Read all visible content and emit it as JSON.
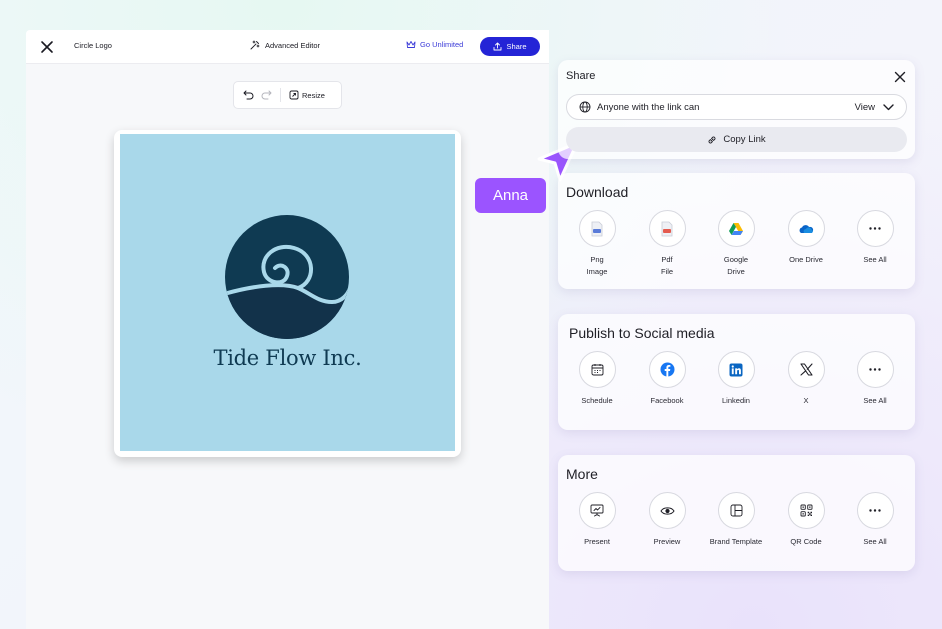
{
  "topbar": {
    "doc_title": "Circle Logo",
    "advanced_editor": "Advanced Editor",
    "go_unlimited": "Go Unlimited",
    "share": "Share"
  },
  "toolbar": {
    "resize": "Resize"
  },
  "canvas": {
    "brand_name": "Tide Flow Inc.",
    "bg_color": "#a9d8ea",
    "logo_color": "#0f3a52"
  },
  "collaborator": {
    "name": "Anna",
    "color": "#9b54ff"
  },
  "share": {
    "title": "Share",
    "access": "Anyone with the link can",
    "permission": "View",
    "copy_link": "Copy Link"
  },
  "download": {
    "title": "Download",
    "items": [
      {
        "label": "Png Image",
        "icon": "png-file-icon"
      },
      {
        "label": "Pdf File",
        "icon": "pdf-file-icon"
      },
      {
        "label": "Google Drive",
        "icon": "google-drive-icon"
      },
      {
        "label": "One Drive",
        "icon": "onedrive-icon"
      },
      {
        "label": "See All",
        "icon": "more-icon"
      }
    ]
  },
  "social": {
    "title": "Publish to Social media",
    "items": [
      {
        "label": "Schedule",
        "icon": "calendar-icon"
      },
      {
        "label": "Facebook",
        "icon": "facebook-icon"
      },
      {
        "label": "Linkedin",
        "icon": "linkedin-icon"
      },
      {
        "label": "X",
        "icon": "x-icon"
      },
      {
        "label": "See All",
        "icon": "more-icon"
      }
    ]
  },
  "more": {
    "title": "More",
    "items": [
      {
        "label": "Present",
        "icon": "present-icon"
      },
      {
        "label": "Preview",
        "icon": "eye-icon"
      },
      {
        "label": "Brand Template",
        "icon": "template-icon"
      },
      {
        "label": "QR Code",
        "icon": "qr-code-icon"
      },
      {
        "label": "See All",
        "icon": "more-icon"
      }
    ]
  },
  "colors": {
    "primary": "#2424d6",
    "accent": "#9b54ff"
  }
}
